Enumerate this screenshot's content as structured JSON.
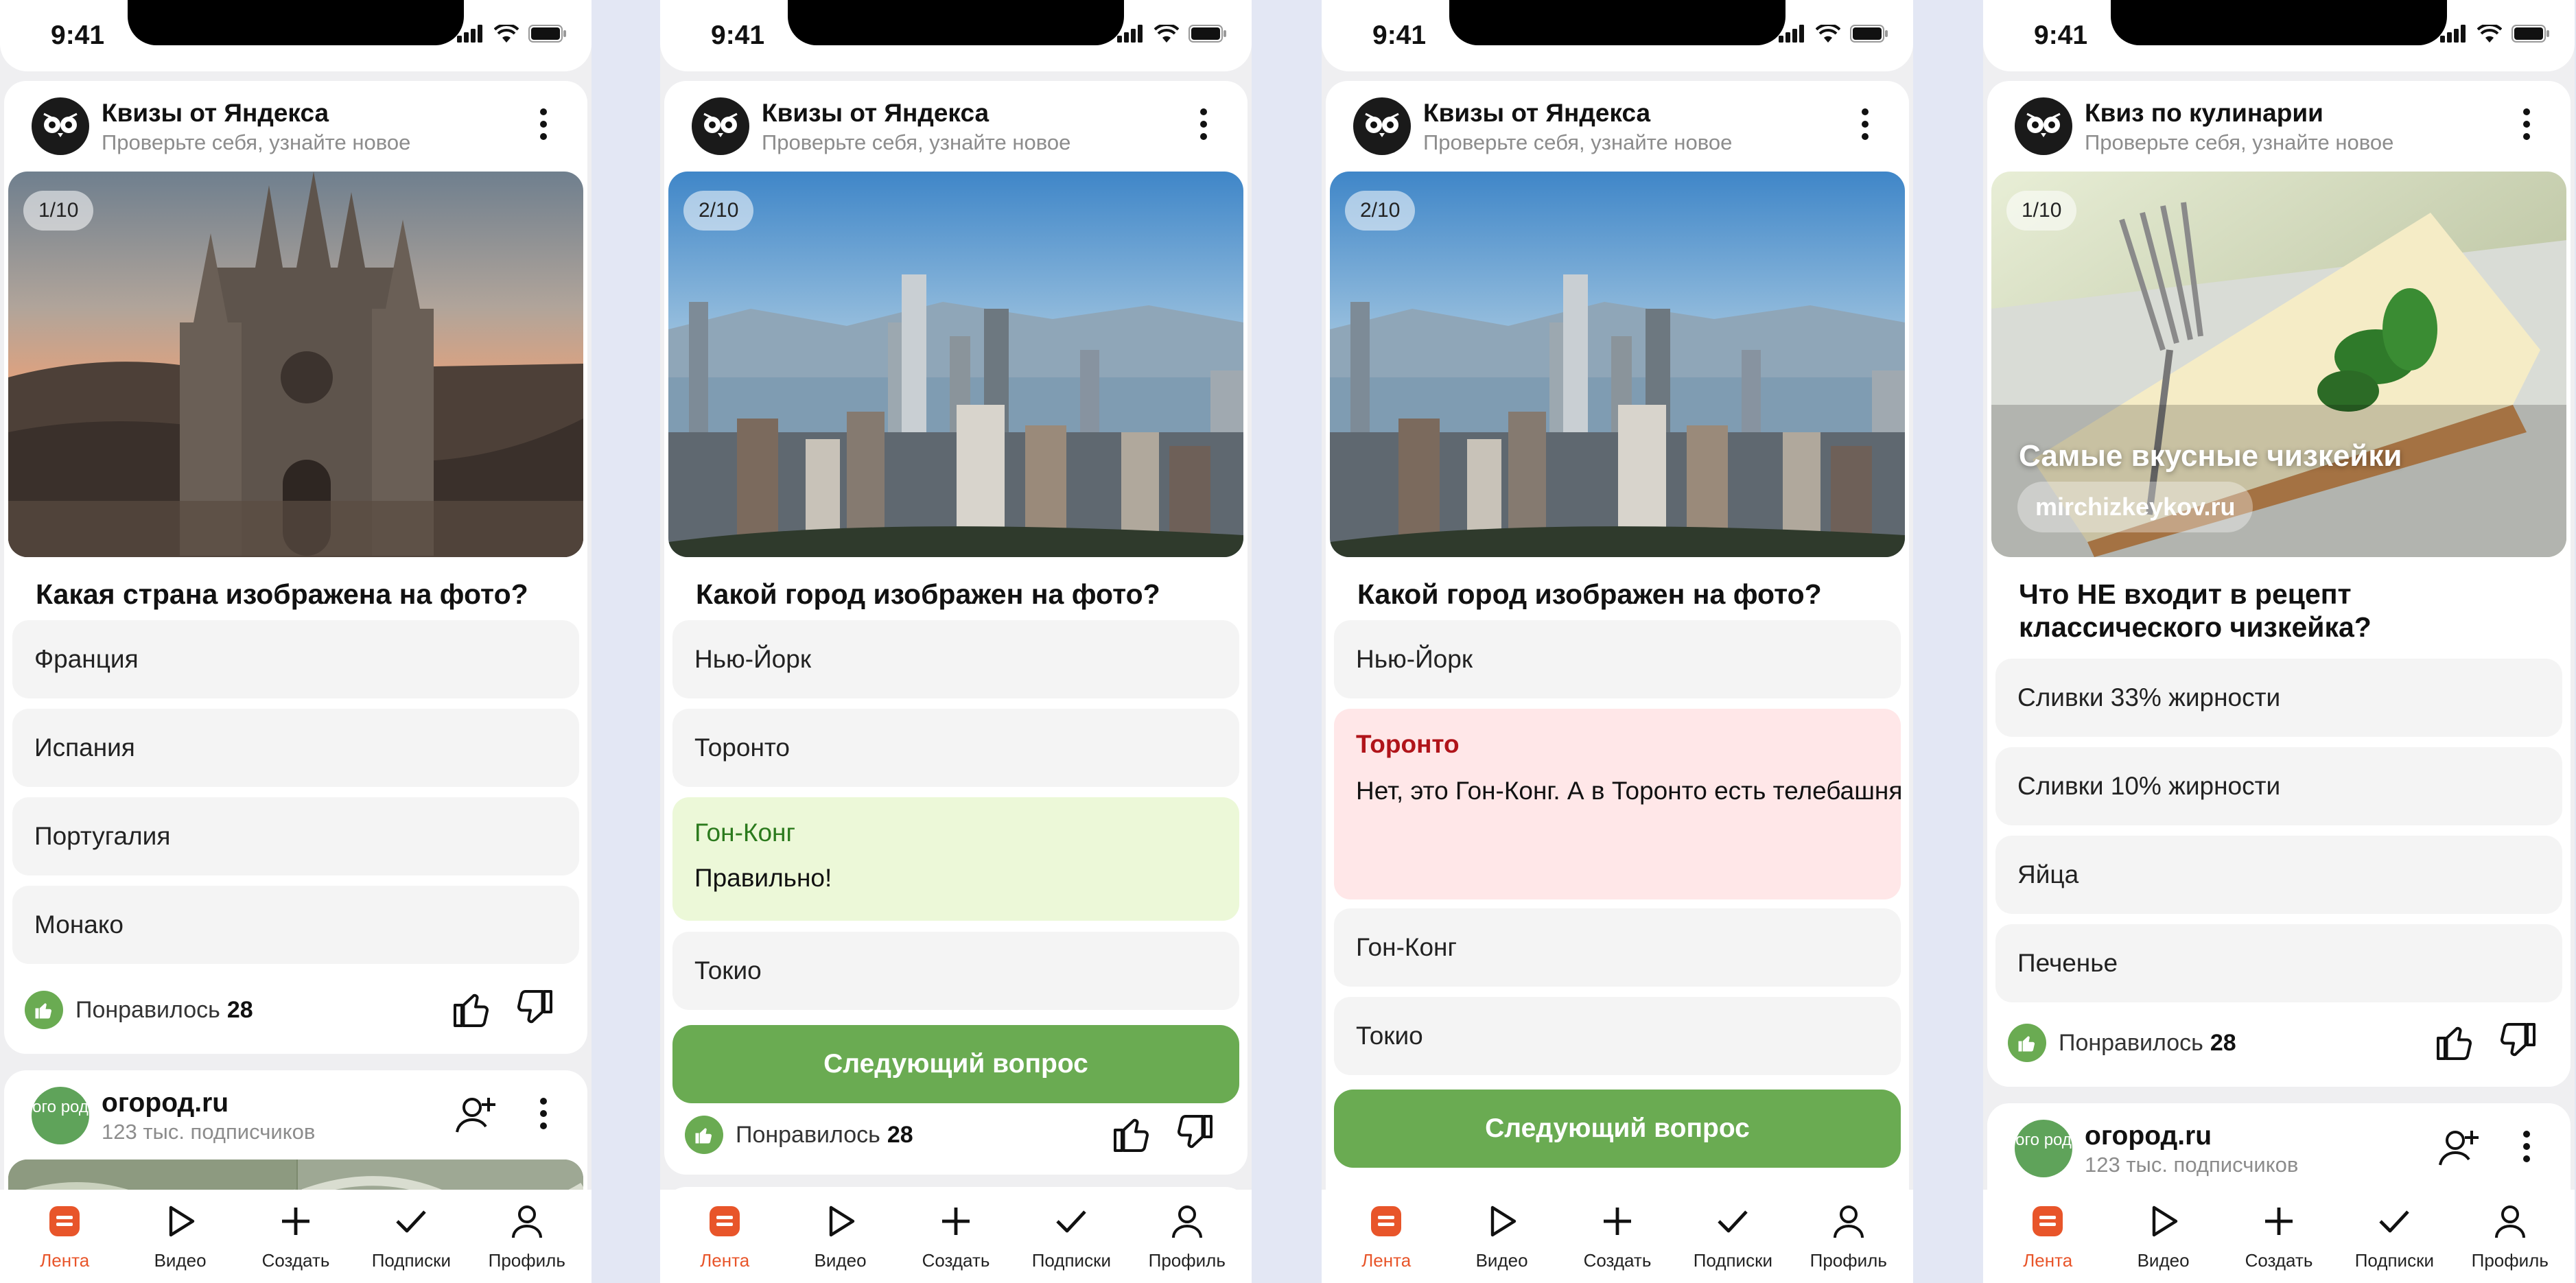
{
  "status_time": "9:41",
  "colors": {
    "accent_green": "#6aab52",
    "tab_active": "#e8552a",
    "wrong_text": "#b0141a",
    "correct_text": "#2b7a1d"
  },
  "tabs": [
    {
      "label": "Лента",
      "icon": "feed-icon"
    },
    {
      "label": "Видео",
      "icon": "play-icon"
    },
    {
      "label": "Создать",
      "icon": "plus-icon"
    },
    {
      "label": "Подписки",
      "icon": "check-icon"
    },
    {
      "label": "Профиль",
      "icon": "profile-icon"
    }
  ],
  "screens": [
    {
      "source_title": "Квизы от Яндекса",
      "source_subtitle": "Проверьте себя, узнайте новое",
      "counter": "1/10",
      "question": "Какая страна изображена на фото?",
      "options": [
        "Франция",
        "Испания",
        "Португалия",
        "Монако"
      ],
      "likes_label": "Понравилось",
      "likes_count": "28",
      "next_post": {
        "title": "огород.ru",
        "subtitle": "123 тыс. подписчиков",
        "avatar_text": "ого род"
      }
    },
    {
      "source_title": "Квизы от Яндекса",
      "source_subtitle": "Проверьте себя, узнайте новое",
      "counter": "2/10",
      "question": "Какой город изображен на фото?",
      "options": [
        "Нью-Йорк",
        "Торонто",
        "Гон-Конг",
        "Токио"
      ],
      "correct_note": "Правильно!",
      "next_button": "Следующий вопрос",
      "likes_label": "Понравилось",
      "likes_count": "28"
    },
    {
      "source_title": "Квизы от Яндекса",
      "source_subtitle": "Проверьте себя, узнайте новое",
      "counter": "2/10",
      "question": "Какой город изображен на фото?",
      "options": [
        "Нью-Йорк",
        "Торонто",
        "Гон-Конг",
        "Токио"
      ],
      "wrong_note": "Нет, это Гон-Конг. А в Торонто есть телебашня CN-Tower, которую видно отовсюду.",
      "next_button": "Следующий вопрос"
    },
    {
      "source_title": "Квиз по кулинарии",
      "source_subtitle": "Проверьте себя, узнайте новое",
      "counter": "1/10",
      "promo_title": "Самые вкусные чизкейки",
      "promo_link": "mirchizkeykov.ru",
      "question": "Что НЕ входит в рецепт классического чизкейка?",
      "options": [
        "Сливки 33% жирности",
        "Сливки 10% жирности",
        "Яйца",
        "Печенье"
      ],
      "likes_label": "Понравилось",
      "likes_count": "28",
      "next_post": {
        "title": "огород.ru",
        "subtitle": "123 тыс. подписчиков",
        "avatar_text": "ого род"
      }
    }
  ]
}
